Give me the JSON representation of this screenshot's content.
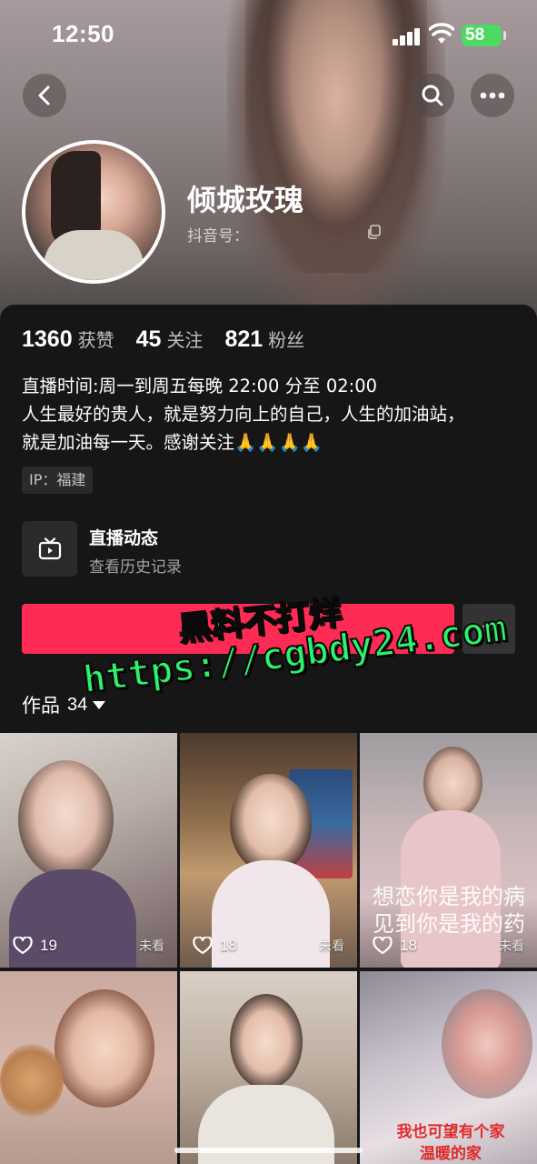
{
  "status_bar": {
    "time": "12:50",
    "battery_level": "58"
  },
  "header": {
    "back_icon": "chevron-left-icon",
    "search_icon": "search-icon",
    "more_icon": "more-horizontal-icon"
  },
  "profile": {
    "name": "倾城玫瑰",
    "douyin_id_label": "抖音号："
  },
  "stats": [
    {
      "value": "1360",
      "label": "获赞"
    },
    {
      "value": "45",
      "label": "关注"
    },
    {
      "value": "821",
      "label": "粉丝"
    }
  ],
  "bio": {
    "line1": "直播时间:周一到周五每晚 22:00 分至 02:00",
    "line2": "人生最好的贵人，就是努力向上的自己，人生的加油站，",
    "line3": "就是加油每一天。感谢关注🙏🙏🙏🙏"
  },
  "ip": "IP：福建",
  "live": {
    "title": "直播动态",
    "subtitle": "查看历史记录",
    "icon": "tv-icon"
  },
  "actions": {
    "follow_color": "#fe2c55",
    "dropdown_icon": "caret-down-icon"
  },
  "works": {
    "label": "作品",
    "count": "34"
  },
  "watermark": {
    "line1": "黑料不打烊",
    "line2": "https://cgbdy24.com"
  },
  "videos": [
    {
      "likes": "19",
      "status": "未看"
    },
    {
      "likes": "18",
      "status": "未看"
    },
    {
      "likes": "18",
      "status": "未看",
      "caption1": "想恋你是我的病",
      "caption2": "见到你是我的药"
    },
    {
      "likes": "",
      "status": ""
    },
    {
      "likes": "",
      "status": ""
    },
    {
      "likes": "",
      "status": "",
      "caption1": "我也可望有个家",
      "caption2": "温暖的家"
    }
  ]
}
